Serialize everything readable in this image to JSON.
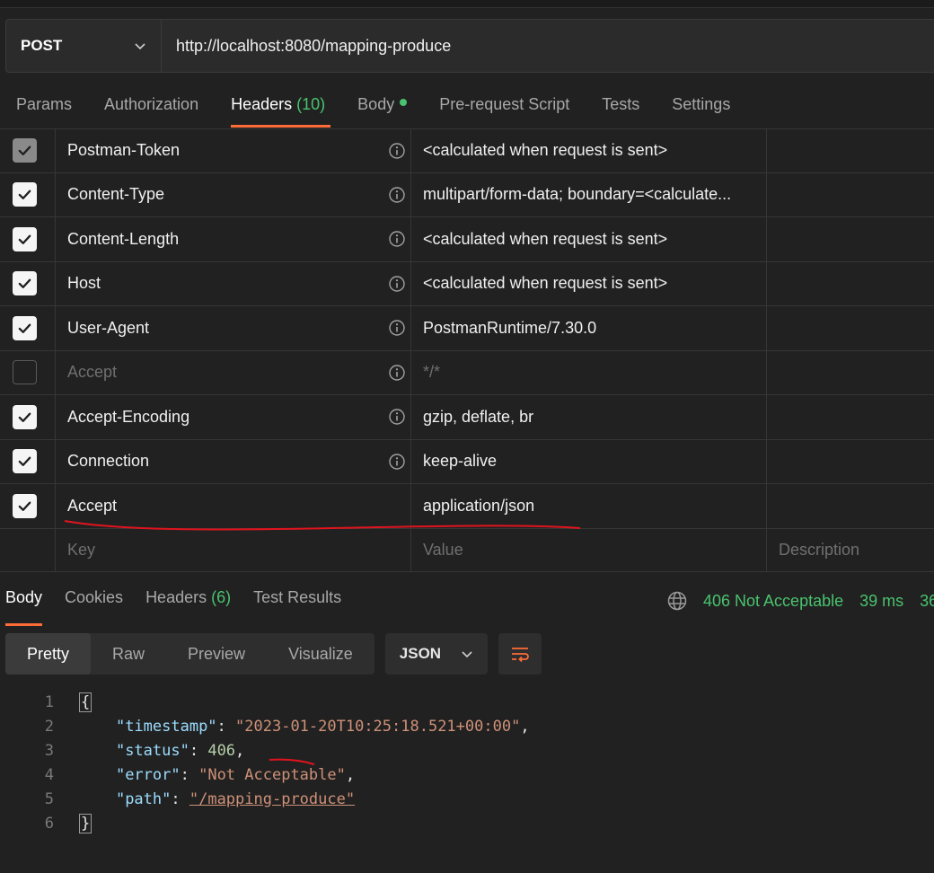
{
  "request": {
    "method": "POST",
    "url": "http://localhost:8080/mapping-produce"
  },
  "request_tabs": [
    {
      "label": "Params"
    },
    {
      "label": "Authorization"
    },
    {
      "label": "Headers",
      "count": "(10)"
    },
    {
      "label": "Body"
    },
    {
      "label": "Pre-request Script"
    },
    {
      "label": "Tests"
    },
    {
      "label": "Settings"
    }
  ],
  "headers": [
    {
      "key": "Postman-Token",
      "value": "<calculated when request is sent>",
      "checked": "grey"
    },
    {
      "key": "Content-Type",
      "value": "multipart/form-data; boundary=<calculate...",
      "checked": "on"
    },
    {
      "key": "Content-Length",
      "value": "<calculated when request is sent>",
      "checked": "on"
    },
    {
      "key": "Host",
      "value": "<calculated when request is sent>",
      "checked": "on"
    },
    {
      "key": "User-Agent",
      "value": "PostmanRuntime/7.30.0",
      "checked": "on"
    },
    {
      "key": "Accept",
      "value": "*/*",
      "checked": "off"
    },
    {
      "key": "Accept-Encoding",
      "value": "gzip, deflate, br",
      "checked": "on"
    },
    {
      "key": "Connection",
      "value": "keep-alive",
      "checked": "on"
    },
    {
      "key": "Accept",
      "value": "application/json",
      "checked": "on"
    }
  ],
  "placeholders": {
    "key": "Key",
    "value": "Value",
    "description": "Description"
  },
  "response_tabs": [
    {
      "label": "Body"
    },
    {
      "label": "Cookies"
    },
    {
      "label": "Headers",
      "count": "(6)"
    },
    {
      "label": "Test Results"
    }
  ],
  "response_status": {
    "status": "406 Not Acceptable",
    "time": "39 ms",
    "size_partial": "36"
  },
  "view_modes": [
    "Pretty",
    "Raw",
    "Preview",
    "Visualize"
  ],
  "format": "JSON",
  "body": {
    "line_numbers": [
      "1",
      "2",
      "3",
      "4",
      "5",
      "6"
    ],
    "open_brace": "{",
    "close_brace": "}",
    "fields": [
      {
        "key": "\"timestamp\"",
        "value": "\"2023-01-20T10:25:18.521+00:00\"",
        "comma": ","
      },
      {
        "key": "\"status\"",
        "value": "406",
        "comma": ","
      },
      {
        "key": "\"error\"",
        "value": "\"Not Acceptable\"",
        "comma": ","
      },
      {
        "key": "\"path\"",
        "value": "\"/mapping-produce\"",
        "comma": ""
      }
    ]
  },
  "colors": {
    "accent": "#ff6c37",
    "success": "#49c36e",
    "json_key": "#9cdcfe",
    "json_string": "#ce9178",
    "json_number": "#b5cea8",
    "annotation": "#e0141e"
  }
}
